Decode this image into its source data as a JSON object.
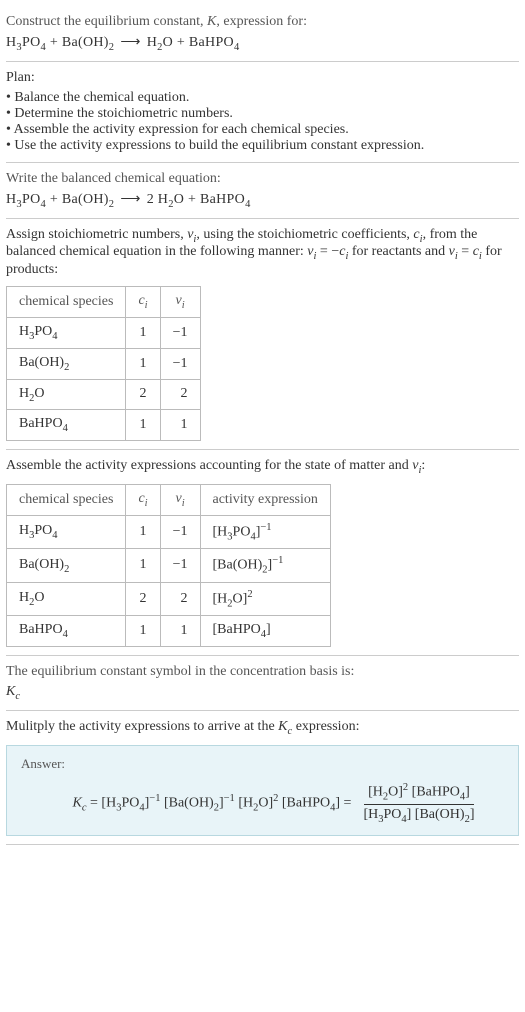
{
  "intro": {
    "prompt1": "Construct the equilibrium constant, ",
    "K": "K",
    "prompt2": ", expression for:"
  },
  "eq1": {
    "s1": "H",
    "s1sub": "3",
    "s2": "PO",
    "s2sub": "4",
    "plus1": " + ",
    "s3": "Ba(OH)",
    "s3sub": "2",
    "arrow": "⟶",
    "p1": "H",
    "p1sub": "2",
    "p1b": "O",
    "plus2": " + ",
    "p2": "BaHPO",
    "p2sub": "4"
  },
  "plan": {
    "header": "Plan:",
    "items": [
      "Balance the chemical equation.",
      "Determine the stoichiometric numbers.",
      "Assemble the activity expression for each chemical species.",
      "Use the activity expressions to build the equilibrium constant expression."
    ]
  },
  "balanced": {
    "header": "Write the balanced chemical equation:"
  },
  "eq2": {
    "s1": "H",
    "s1sub": "3",
    "s2": "PO",
    "s2sub": "4",
    "plus1": " + ",
    "s3": "Ba(OH)",
    "s3sub": "2",
    "arrow": "⟶",
    "coef": "2 ",
    "p1": "H",
    "p1sub": "2",
    "p1b": "O",
    "plus2": " + ",
    "p2": "BaHPO",
    "p2sub": "4"
  },
  "stoich": {
    "text1": "Assign stoichiometric numbers, ",
    "nu": "ν",
    "nusub": "i",
    "text2": ", using the stoichiometric coefficients, ",
    "c": "c",
    "csub": "i",
    "text3": ", from the balanced chemical equation in the following manner: ",
    "nu2": "ν",
    "nu2sub": "i",
    "eq1": " = −",
    "c2": "c",
    "c2sub": "i",
    "text4": " for reactants and ",
    "nu3": "ν",
    "nu3sub": "i",
    "eq2": " = ",
    "c3": "c",
    "c3sub": "i",
    "text5": " for products:"
  },
  "table1": {
    "headers": {
      "h1": "chemical species",
      "h2a": "c",
      "h2b": "i",
      "h3a": "ν",
      "h3b": "i"
    },
    "rows": [
      {
        "sp": [
          "H",
          "3",
          "PO",
          "4"
        ],
        "c": "1",
        "nu": "−1"
      },
      {
        "sp": [
          "Ba(OH)",
          "2",
          "",
          ""
        ],
        "c": "1",
        "nu": "−1"
      },
      {
        "sp": [
          "H",
          "2",
          "O",
          ""
        ],
        "c": "2",
        "nu": "2"
      },
      {
        "sp": [
          "BaHPO",
          "4",
          "",
          ""
        ],
        "c": "1",
        "nu": "1"
      }
    ]
  },
  "activity": {
    "text1": "Assemble the activity expressions accounting for the state of matter and ",
    "nu": "ν",
    "nusub": "i",
    "text2": ":"
  },
  "table2": {
    "headers": {
      "h1": "chemical species",
      "h2a": "c",
      "h2b": "i",
      "h3a": "ν",
      "h3b": "i",
      "h4": "activity expression"
    },
    "rows": [
      {
        "sp": [
          "H",
          "3",
          "PO",
          "4"
        ],
        "c": "1",
        "nu": "−1",
        "act": [
          "[H",
          "3",
          "PO",
          "4",
          "]",
          "−1"
        ]
      },
      {
        "sp": [
          "Ba(OH)",
          "2",
          "",
          ""
        ],
        "c": "1",
        "nu": "−1",
        "act": [
          "[Ba(OH)",
          "2",
          "",
          "",
          "]",
          "−1"
        ]
      },
      {
        "sp": [
          "H",
          "2",
          "O",
          ""
        ],
        "c": "2",
        "nu": "2",
        "act": [
          "[H",
          "2",
          "O",
          "",
          "]",
          "2"
        ]
      },
      {
        "sp": [
          "BaHPO",
          "4",
          "",
          ""
        ],
        "c": "1",
        "nu": "1",
        "act": [
          "[BaHPO",
          "4",
          "",
          "",
          "]",
          ""
        ]
      }
    ]
  },
  "kcstatement": {
    "text": "The equilibrium constant symbol in the concentration basis is:",
    "K": "K",
    "Ksub": "c"
  },
  "multiply": {
    "text1": "Mulitply the activity expressions to arrive at the ",
    "K": "K",
    "Ksub": "c",
    "text2": " expression:"
  },
  "answer": {
    "label": "Answer:",
    "K": "K",
    "Ksub": "c",
    "eq": " = ",
    "t1": "[H",
    "t1s": "3",
    "t1b": "PO",
    "t1s2": "4",
    "t1c": "]",
    "t1e": "−1",
    "t2": " [Ba(OH)",
    "t2s": "2",
    "t2c": "]",
    "t2e": "−1",
    "t3": " [H",
    "t3s": "2",
    "t3b": "O]",
    "t3e": "2",
    "t4": " [BaHPO",
    "t4s": "4",
    "t4c": "]",
    "eq2": " = ",
    "num1": "[H",
    "num1s": "2",
    "num1b": "O]",
    "num1e": "2",
    "num2": " [BaHPO",
    "num2s": "4",
    "num2c": "]",
    "den1": "[H",
    "den1s": "3",
    "den1b": "PO",
    "den1s2": "4",
    "den1c": "]",
    "den2": " [Ba(OH)",
    "den2s": "2",
    "den2c": "]"
  }
}
